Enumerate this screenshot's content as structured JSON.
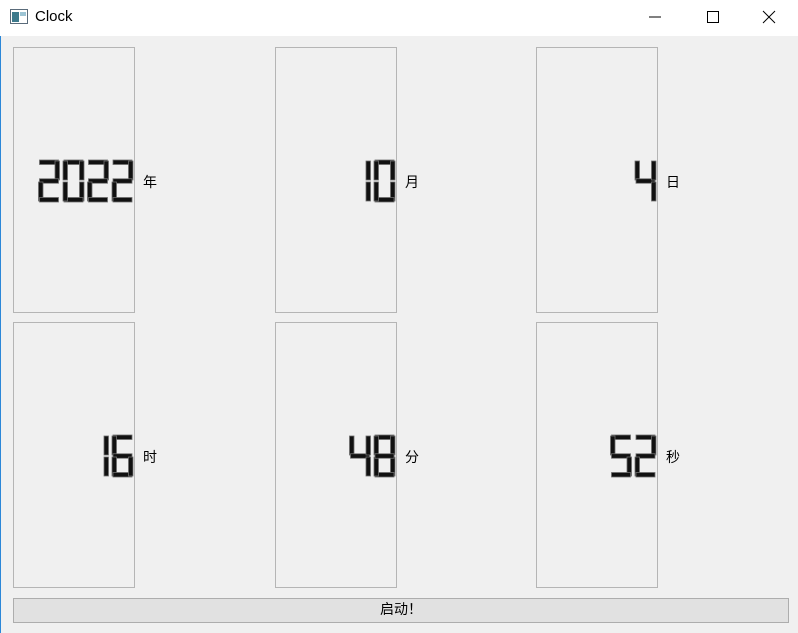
{
  "window": {
    "title": "Clock"
  },
  "displays": [
    {
      "value": "2022",
      "unit": "年"
    },
    {
      "value": "10",
      "unit": "月"
    },
    {
      "value": "4",
      "unit": "日"
    },
    {
      "value": "16",
      "unit": "时"
    },
    {
      "value": "48",
      "unit": "分"
    },
    {
      "value": "52",
      "unit": "秒"
    }
  ],
  "start_button": {
    "label": "启动！"
  }
}
